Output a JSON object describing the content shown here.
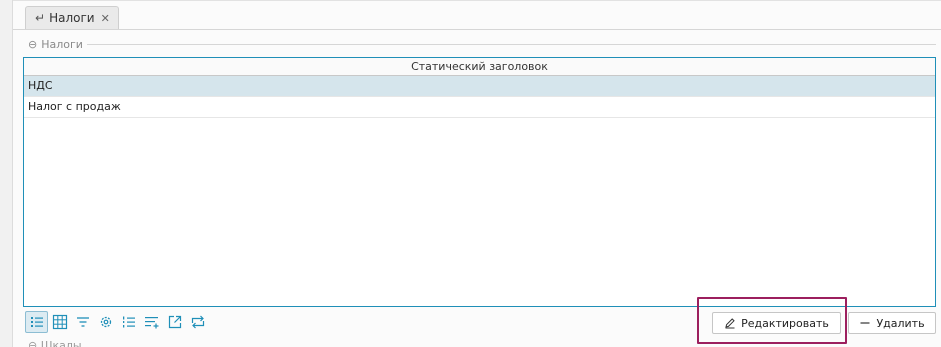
{
  "tab": {
    "label": "Налоги",
    "back_icon": "return-arrow-icon",
    "close_glyph": "✕"
  },
  "group": {
    "collapse_glyph": "⊖",
    "title": "Налоги"
  },
  "grid": {
    "header": "Статический заголовок",
    "rows": [
      "НДС",
      "Налог с продаж"
    ],
    "selected_row": 0
  },
  "toolbar": {
    "icons": [
      "list-view-icon",
      "table-view-icon",
      "filter-icon",
      "settings-gear-icon",
      "numbered-list-icon",
      "sort-add-icon",
      "open-external-icon",
      "sync-icon"
    ]
  },
  "actions": {
    "edit_label": "Редактировать",
    "delete_label": "Удалить"
  },
  "next_group": {
    "collapse_glyph": "⊖",
    "title": "Шкалы"
  },
  "colors": {
    "accent": "#1f8fb8",
    "selection": "#d5e5ec",
    "highlight": "#9c1f5e"
  }
}
